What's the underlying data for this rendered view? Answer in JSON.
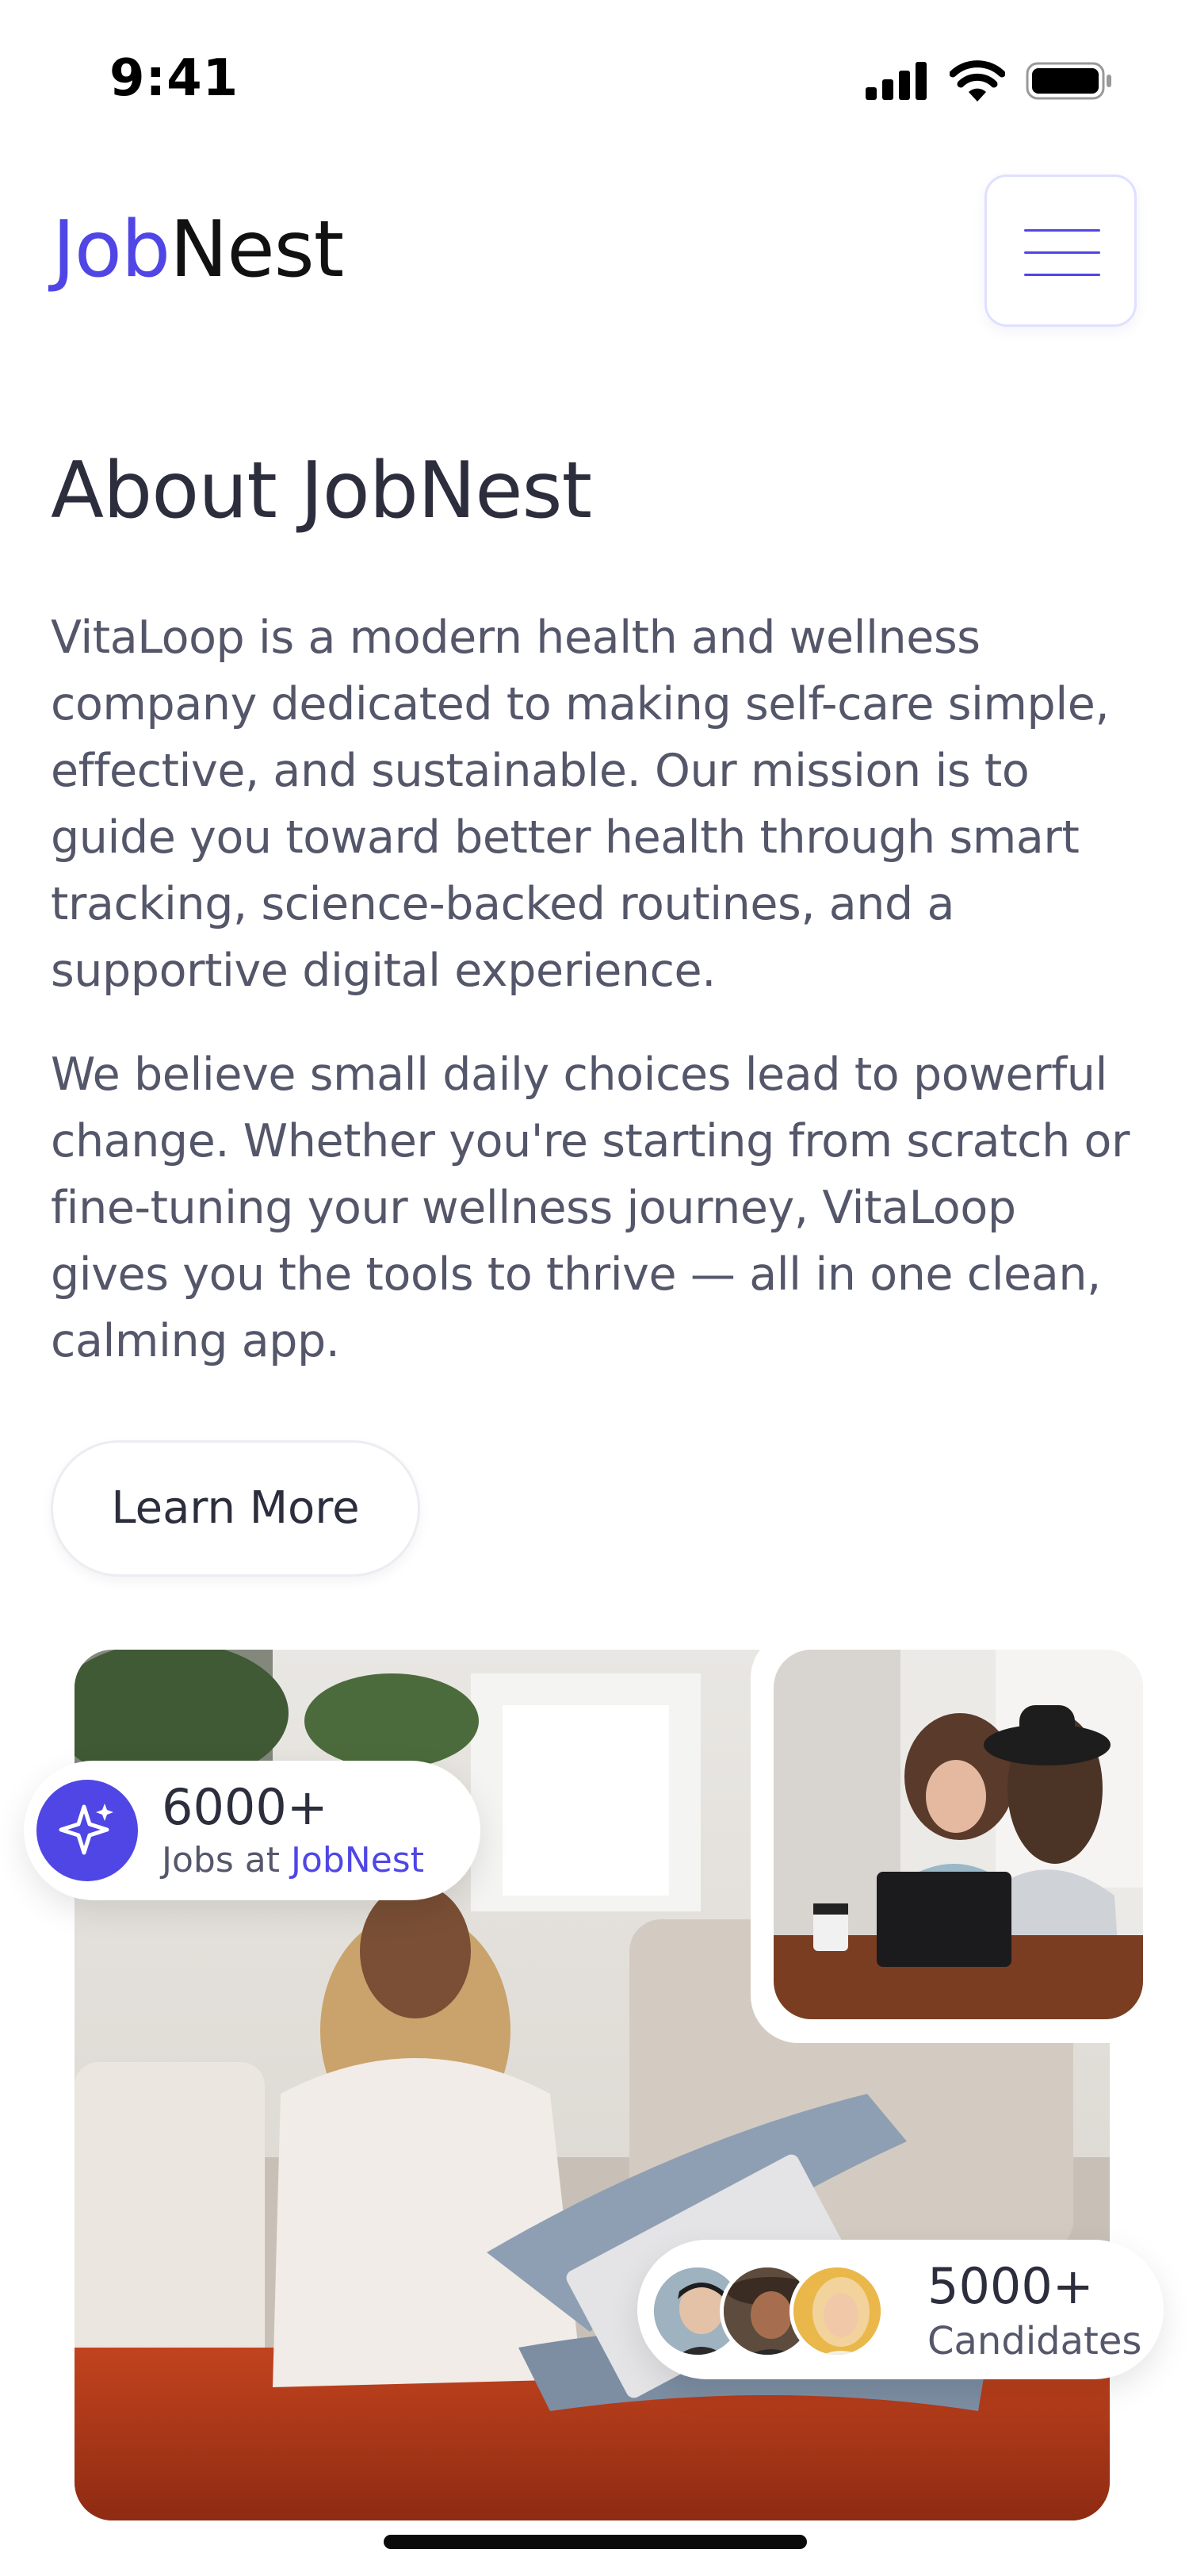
{
  "status_bar": {
    "time": "9:41"
  },
  "header": {
    "logo_part1": "Job",
    "logo_part2": "Nest"
  },
  "about": {
    "title": "About JobNest",
    "paragraph1": "VitaLoop is a modern health and wellness company dedicated to making self-care simple, effective, and sustainable. Our mission is to guide you toward better health through smart tracking, science-backed routines, and a supportive digital experience.",
    "paragraph2": "We believe small daily choices lead to powerful change. Whether you're starting from scratch or fine-tuning your wellness journey, VitaLoop gives you the tools to thrive — all in one clean, calming app.",
    "cta_label": "Learn More"
  },
  "stats": {
    "jobs_count": "6000+",
    "jobs_prefix": "Jobs at",
    "jobs_brand": "JobNest",
    "candidates_count": "5000+",
    "candidates_label": "Candidates"
  },
  "colors": {
    "brand": "#4f46e5",
    "text_dark": "#2c2e3d",
    "text_body": "#54566a"
  },
  "icons": [
    "signal-icon",
    "wifi-icon",
    "battery-icon",
    "menu-icon",
    "sparkle-icon"
  ]
}
